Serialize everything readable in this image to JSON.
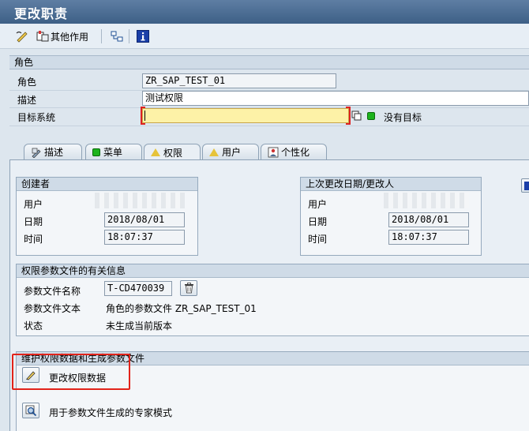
{
  "window": {
    "title": "更改职责"
  },
  "toolbar": {
    "other_functions": "其他作用"
  },
  "role_section": {
    "header": "角色",
    "role_label": "角色",
    "role_value": "ZR_SAP_TEST_01",
    "desc_label": "描述",
    "desc_value": "测试权限",
    "target_label": "目标系统",
    "target_value": "",
    "no_target": "没有目标"
  },
  "tabs": [
    {
      "label": "描述",
      "icon": "pencil-icon"
    },
    {
      "label": "菜单",
      "icon": "green-status-icon"
    },
    {
      "label": "权限",
      "icon": "yellow-triangle-icon"
    },
    {
      "label": "用户",
      "icon": "yellow-triangle-icon"
    },
    {
      "label": "个性化",
      "icon": "personalization-icon"
    }
  ],
  "created": {
    "header": "创建者",
    "user_label": "用户",
    "date_label": "日期",
    "date_value": "2018/08/01",
    "time_label": "时间",
    "time_value": "18:07:37"
  },
  "changed": {
    "header": "上次更改日期/更改人",
    "user_label": "用户",
    "date_label": "日期",
    "date_value": "2018/08/01",
    "time_label": "时间",
    "time_value": "18:07:37"
  },
  "profile": {
    "header": "权限参数文件的有关信息",
    "name_label": "参数文件名称",
    "name_value": "T-CD470039",
    "text_label": "参数文件文本",
    "text_value": "角色的参数文件 ZR_SAP_TEST_01",
    "status_label": "状态",
    "status_value": "未生成当前版本"
  },
  "maintain": {
    "header": "维护权限数据和生成参数文件",
    "change_auth": "更改权限数据",
    "expert_mode": "用于参数文件生成的专家模式"
  },
  "colors": {
    "title_bar": "#4a6b92",
    "highlight": "#e2231a",
    "required_field": "#fdf2a7"
  }
}
